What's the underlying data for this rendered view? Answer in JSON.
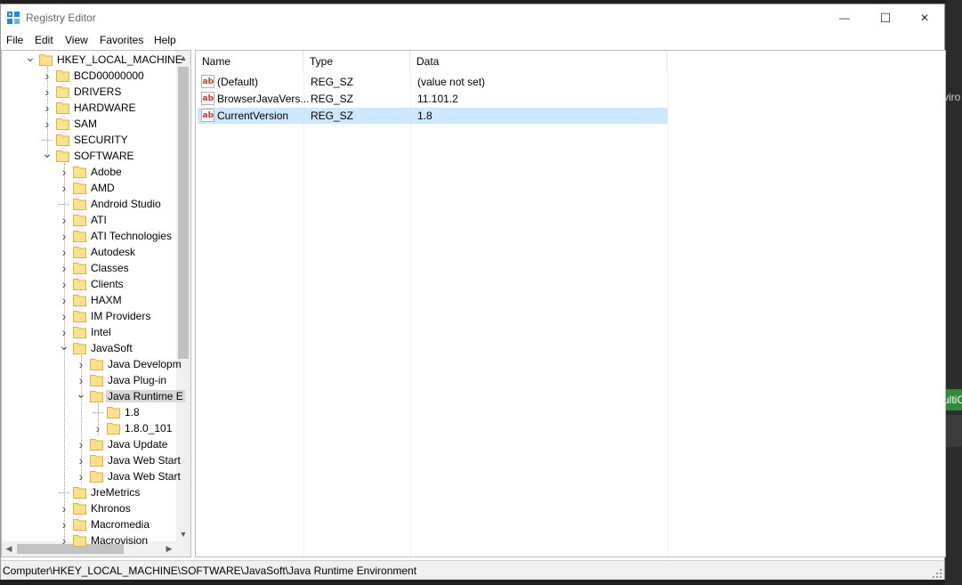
{
  "window": {
    "title": "Registry Editor"
  },
  "titlebar_buttons": {
    "minimize": "—",
    "maximize": "☐",
    "close": "✕"
  },
  "menu": [
    "File",
    "Edit",
    "View",
    "Favorites",
    "Help"
  ],
  "tree": [
    {
      "label": "HKEY_LOCAL_MACHINE",
      "level": 0,
      "exp": "v"
    },
    {
      "label": "BCD00000000",
      "level": 1,
      "exp": ">"
    },
    {
      "label": "DRIVERS",
      "level": 1,
      "exp": ">"
    },
    {
      "label": "HARDWARE",
      "level": 1,
      "exp": ">"
    },
    {
      "label": "SAM",
      "level": 1,
      "exp": ">"
    },
    {
      "label": "SECURITY",
      "level": 1,
      "exp": ""
    },
    {
      "label": "SOFTWARE",
      "level": 1,
      "exp": "v"
    },
    {
      "label": "Adobe",
      "level": 2,
      "exp": ">"
    },
    {
      "label": "AMD",
      "level": 2,
      "exp": ">"
    },
    {
      "label": "Android Studio",
      "level": 2,
      "exp": ""
    },
    {
      "label": "ATI",
      "level": 2,
      "exp": ">"
    },
    {
      "label": "ATI Technologies",
      "level": 2,
      "exp": ">"
    },
    {
      "label": "Autodesk",
      "level": 2,
      "exp": ">"
    },
    {
      "label": "Classes",
      "level": 2,
      "exp": ">"
    },
    {
      "label": "Clients",
      "level": 2,
      "exp": ">"
    },
    {
      "label": "HAXM",
      "level": 2,
      "exp": ">"
    },
    {
      "label": "IM Providers",
      "level": 2,
      "exp": ">"
    },
    {
      "label": "Intel",
      "level": 2,
      "exp": ">"
    },
    {
      "label": "JavaSoft",
      "level": 2,
      "exp": "v"
    },
    {
      "label": "Java Developm",
      "level": 3,
      "exp": ">"
    },
    {
      "label": "Java Plug-in",
      "level": 3,
      "exp": ">"
    },
    {
      "label": "Java Runtime E",
      "level": 3,
      "exp": "v",
      "selected": true
    },
    {
      "label": "1.8",
      "level": 4,
      "exp": ""
    },
    {
      "label": "1.8.0_101",
      "level": 4,
      "exp": ">"
    },
    {
      "label": "Java Update",
      "level": 3,
      "exp": ">"
    },
    {
      "label": "Java Web Start",
      "level": 3,
      "exp": ">"
    },
    {
      "label": "Java Web Start",
      "level": 3,
      "exp": ">"
    },
    {
      "label": "JreMetrics",
      "level": 2,
      "exp": ""
    },
    {
      "label": "Khronos",
      "level": 2,
      "exp": ">"
    },
    {
      "label": "Macromedia",
      "level": 2,
      "exp": ">"
    },
    {
      "label": "Macrovision",
      "level": 2,
      "exp": ">"
    }
  ],
  "columns": {
    "name": "Name",
    "type": "Type",
    "data": "Data"
  },
  "values": [
    {
      "name": "(Default)",
      "type": "REG_SZ",
      "data": "(value not set)",
      "icon": "string-value-icon"
    },
    {
      "name": "BrowserJavaVers...",
      "type": "REG_SZ",
      "data": "11.101.2",
      "icon": "string-value-icon"
    },
    {
      "name": "CurrentVersion",
      "type": "REG_SZ",
      "data": "1.8",
      "icon": "string-value-icon",
      "selected": true
    }
  ],
  "status": {
    "path": "Computer\\HKEY_LOCAL_MACHINE\\SOFTWARE\\JavaSoft\\Java Runtime Environment"
  },
  "background": {
    "text1": "viro",
    "text2": "ultiC"
  }
}
